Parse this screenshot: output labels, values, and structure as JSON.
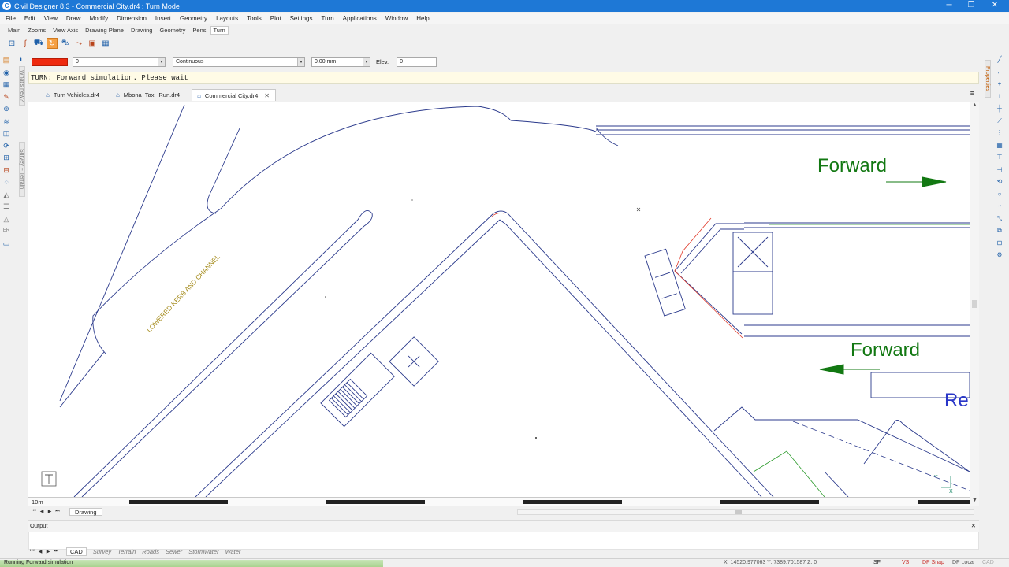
{
  "window": {
    "title": "Civil Designer 8.3 - Commercial City.dr4 : Turn Mode",
    "controls": {
      "minimize": "─",
      "restore": "❐",
      "close": "✕"
    }
  },
  "menu": [
    "File",
    "Edit",
    "View",
    "Draw",
    "Modify",
    "Dimension",
    "Insert",
    "Geometry",
    "Layouts",
    "Tools",
    "Plot",
    "Settings",
    "Turn",
    "Applications",
    "Window",
    "Help"
  ],
  "ribbon_tabs": [
    "Main",
    "Zooms",
    "View Axis",
    "Drawing Plane",
    "Drawing",
    "Geometry",
    "Pens",
    "Turn"
  ],
  "ribbon_active": "Turn",
  "toolbar_icons": [
    "select-icon",
    "curve-icon",
    "vehicle-edit-icon",
    "turn-mode-icon",
    "vehicle-icon",
    "route-icon",
    "template-icon",
    "table-icon"
  ],
  "properties": {
    "color": "#ee2a10",
    "layer_value": "0",
    "linetype": "Continuous",
    "pen_width": "0.00 mm",
    "elev_label": "Elev.",
    "elev_value": "0"
  },
  "command_line": "TURN: Forward simulation. Please wait",
  "doc_tabs": [
    {
      "label": "Turn Vehicles.dr4",
      "active": false
    },
    {
      "label": "Mbona_Taxi_Run.dr4",
      "active": false
    },
    {
      "label": "Commercial City.dr4",
      "active": true
    }
  ],
  "side_tabs": {
    "whats_new": "What's new?",
    "survey_terrain": "Survey + Terrain",
    "properties": "Properties"
  },
  "drawing": {
    "forward_top": "Forward",
    "forward_bottom": "Forward",
    "re_text": "Re",
    "kerb_label": "LOWERED KERB AND CHANNEL",
    "ucs_y": "Y",
    "ucs_x": "X"
  },
  "scale_label": "10m",
  "layout_tab": "Drawing",
  "output_title": "Output",
  "bottom_tabs": [
    {
      "label": "CAD",
      "active": true
    },
    {
      "label": "Survey",
      "active": false
    },
    {
      "label": "Terrain",
      "active": false
    },
    {
      "label": "Roads",
      "active": false
    },
    {
      "label": "Sewer",
      "active": false
    },
    {
      "label": "Stormwater",
      "active": false
    },
    {
      "label": "Water",
      "active": false
    }
  ],
  "status": {
    "text": "Running Forward simulation",
    "progress": 0.38,
    "coords": "X: 14520.977063  Y: 7389.701587  Z: 0",
    "flags": [
      "SF",
      "VS",
      "DP Snap",
      "DP Local",
      "CAD"
    ]
  }
}
